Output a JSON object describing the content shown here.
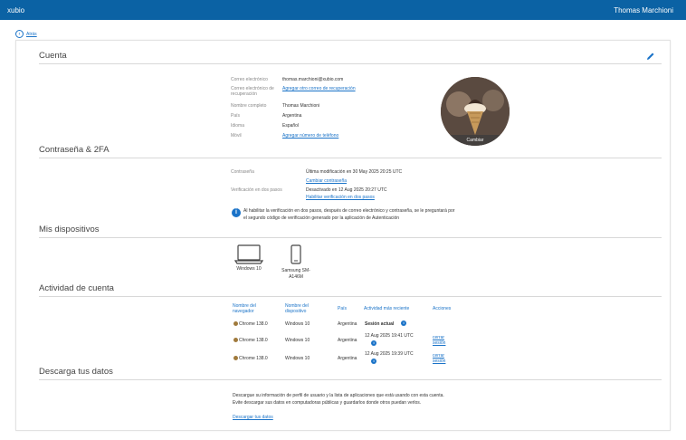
{
  "topbar": {
    "brand": "xubio",
    "user": "Thomas Marchioni"
  },
  "back": {
    "label": "Atrás"
  },
  "account": {
    "title": "Cuenta",
    "fields": [
      {
        "label": "Correo electrónico",
        "value": "thomas.marchioni@xubio.com"
      },
      {
        "label": "Correo electrónico de recuperación",
        "link": "Agregar otro correo de recuperación"
      },
      {
        "label": "Nombre completo",
        "value": "Thomas Marchioni"
      },
      {
        "label": "País",
        "value": "Argentina"
      },
      {
        "label": "Idioma",
        "value": "Español"
      },
      {
        "label": "Móvil",
        "link": "Agregar número de teléfono"
      }
    ],
    "avatar_change": "Cambiar"
  },
  "security": {
    "title": "Contraseña & 2FA",
    "password_label": "Contraseña",
    "password_value": "Última modificación en 30 May 2025 20:25 UTC",
    "password_link": "Cambiar contraseña",
    "twofa_label": "Verificación en dos pasos",
    "twofa_value": "Desactivado en 12 Aug 2025 20:27 UTC",
    "twofa_link": "Habilitar verificación en dos pasos",
    "info_line1": "Al habilitar la verificación en dos pasos, después de correo electrónico y contraseña, se le preguntará por",
    "info_line2": "el segundo código de verificación generado por la aplicación de Autenticación"
  },
  "devices": {
    "title": "Mis dispositivos",
    "items": [
      {
        "name": "Windows 10",
        "icon": "laptop-icon"
      },
      {
        "name_line1": "Samsung SM-",
        "name_line2": "A146M",
        "icon": "phone-icon"
      }
    ]
  },
  "activity": {
    "title": "Actividad de cuenta",
    "headers": {
      "browser_1": "Nombre del",
      "browser_2": "navegador",
      "device_1": "Nombre del",
      "device_2": "dispositivo",
      "country": "País",
      "recent": "Actividad más reciente",
      "actions": "Acciones"
    },
    "rows": [
      {
        "browser": "Chrome 138.0",
        "device": "Windows 10",
        "country": "Argentina",
        "recent": "Sesión actual",
        "action_1": "",
        "action_2": ""
      },
      {
        "browser": "Chrome 138.0",
        "device": "Windows 10",
        "country": "Argentina",
        "recent": "12 Aug 2025 19:41 UTC",
        "action_1": "cerrar",
        "action_2": "sesión"
      },
      {
        "browser": "Chrome 138.0",
        "device": "Windows 10",
        "country": "Argentina",
        "recent": "12 Aug 2025 19:39 UTC",
        "action_1": "cerrar",
        "action_2": "sesión"
      }
    ]
  },
  "download": {
    "title": "Descarga tus datos",
    "line1": "Descargue su información de perfil de usuario y la lista de aplicaciones que está usando con esta cuenta.",
    "line2": "Evite descargar sus datos en computadoras públicas y guardarlos donde otros puedan verlos.",
    "link": "Descargar tus datos"
  },
  "colors": {
    "topbar": "#0b62a4",
    "link": "#1a73c8"
  }
}
